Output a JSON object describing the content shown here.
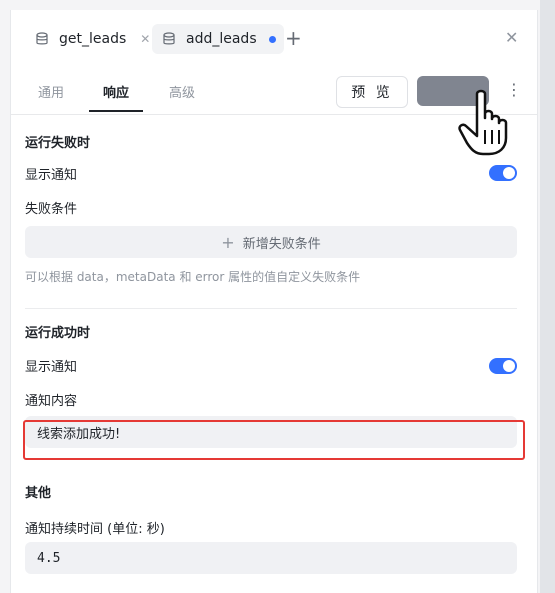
{
  "file_tabs": [
    {
      "label": "get_leads",
      "icon": "database-icon",
      "closable": true
    },
    {
      "label": "add_leads",
      "icon": "database-icon",
      "unsaved": true
    }
  ],
  "icons": {
    "add_tab": "plus-icon",
    "close_panel": "close-icon",
    "more": "more-vertical-icon",
    "cursor": "hand-pointer-icon"
  },
  "sub_tabs": [
    "通用",
    "响应",
    "高级"
  ],
  "active_sub_tab": "响应",
  "actions": {
    "preview_label": "预 览",
    "save_label": ""
  },
  "failure_section": {
    "title": "运行失败时",
    "show_notice_label": "显示通知",
    "show_notice_enabled": true,
    "condition_label": "失败条件",
    "add_condition_label": "新增失败条件",
    "hint": "可以根据 data，metaData 和 error 属性的值自定义失败条件"
  },
  "success_section": {
    "title": "运行成功时",
    "show_notice_label": "显示通知",
    "show_notice_enabled": true,
    "content_label": "通知内容",
    "content_value": "线索添加成功!"
  },
  "other_section": {
    "title": "其他",
    "duration_label": "通知持续时间 (单位: 秒)",
    "duration_value": "4.5"
  },
  "colors": {
    "accent": "#3370ff",
    "highlight_border": "#e53935",
    "save_button": "#808590"
  }
}
